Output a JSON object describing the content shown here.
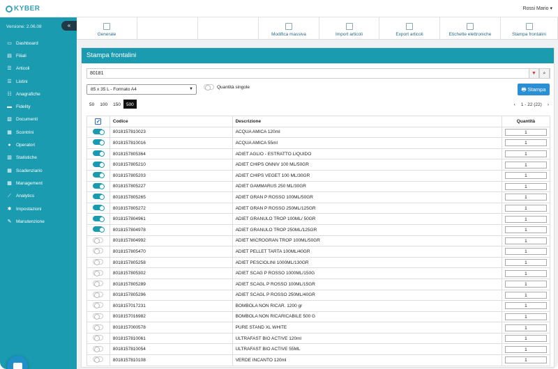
{
  "app": {
    "logo": "KYBER",
    "version": "Versione: 2.06.08",
    "user": "Rossi Mario ▾"
  },
  "sidebar": {
    "items": [
      {
        "label": "Dashboard",
        "icon": "monitor-icon"
      },
      {
        "label": "Filiali",
        "icon": "building-icon"
      },
      {
        "label": "Articoli",
        "icon": "list-icon"
      },
      {
        "label": "Listini",
        "icon": "list-icon"
      },
      {
        "label": "Anagrafiche",
        "icon": "users-icon"
      },
      {
        "label": "Fidelity",
        "icon": "card-icon"
      },
      {
        "label": "Documenti",
        "icon": "folder-icon"
      },
      {
        "label": "Scontrini",
        "icon": "receipt-icon"
      },
      {
        "label": "Operatori",
        "icon": "user-icon"
      },
      {
        "label": "Statistiche",
        "icon": "bar-chart-icon"
      },
      {
        "label": "Scadenziario",
        "icon": "calendar-icon"
      },
      {
        "label": "Management",
        "icon": "grid-icon"
      },
      {
        "label": "Analytics",
        "icon": "line-chart-icon"
      },
      {
        "label": "Impostazioni",
        "icon": "gear-icon"
      },
      {
        "label": "Manutenzione",
        "icon": "wrench-icon"
      }
    ]
  },
  "toolbar": {
    "items": [
      {
        "label": "Generale",
        "width": 87
      },
      {
        "label": "",
        "width": 87
      },
      {
        "label": "",
        "width": 87
      },
      {
        "label": "Modifica massiva",
        "width": 87
      },
      {
        "label": "Import articoli",
        "width": 86
      },
      {
        "label": "Export articoli",
        "width": 87
      },
      {
        "label": "Etichette elettroniche",
        "width": 87
      },
      {
        "label": "Stampa frontalini",
        "width": 82
      }
    ]
  },
  "panel": {
    "title": "Stampa frontalini",
    "search_value": "80181",
    "format_selected": "85 x 35 L - Formato A4",
    "qty_single_label": "Quantità singole",
    "print_label": "Stampa",
    "page_sizes": [
      "50",
      "100",
      "150",
      "500"
    ],
    "page_size_active": "500",
    "page_info": "1 - 22 (22)",
    "columns": {
      "codice": "Codice",
      "descrizione": "Descrizione",
      "quantita": "Quantità"
    }
  },
  "rows": [
    {
      "on": true,
      "codice": "8018157810023",
      "descrizione": "ACQUA AMICA 120ml",
      "qty": "1"
    },
    {
      "on": true,
      "codice": "8018157810016",
      "descrizione": "ACQUA AMICA 55ml",
      "qty": "1"
    },
    {
      "on": true,
      "codice": "8018157805364",
      "descrizione": "ADIET AGLIO - ESTRATTO LIQUIDO",
      "qty": "1"
    },
    {
      "on": true,
      "codice": "8018157805210",
      "descrizione": "ADIET CHIPS ONNIV 100 ML/50GR",
      "qty": "1"
    },
    {
      "on": true,
      "codice": "8018157805203",
      "descrizione": "ADIET CHIPS VEGET 100 ML/30GR",
      "qty": "1"
    },
    {
      "on": true,
      "codice": "8018157805227",
      "descrizione": "ADIET GAMMARUS 250 ML/30GR",
      "qty": "1"
    },
    {
      "on": true,
      "codice": "8018157805265",
      "descrizione": "ADIET GRAN P ROSSO 100ML/50GR",
      "qty": "1"
    },
    {
      "on": true,
      "codice": "8018157805272",
      "descrizione": "ADIET GRAN P ROSSO 250ML/125GR",
      "qty": "1"
    },
    {
      "on": true,
      "codice": "8018157804961",
      "descrizione": "ADIET GRANULO TROP 100ML/ 50GR",
      "qty": "1"
    },
    {
      "on": true,
      "codice": "8018157804978",
      "descrizione": "ADIET GRANULO TROP 250ML/125GR",
      "qty": "1"
    },
    {
      "on": false,
      "codice": "8018157804992",
      "descrizione": "ADIET MICROGRAN TROP 100ML/50GR",
      "qty": "1"
    },
    {
      "on": false,
      "codice": "8018157805470",
      "descrizione": "ADIET PELLET TARTA 100ML/40GR",
      "qty": "1"
    },
    {
      "on": false,
      "codice": "8018157805258",
      "descrizione": "ADIET PESCIOLINI 1000ML/130GR",
      "qty": "1"
    },
    {
      "on": false,
      "codice": "8018157805302",
      "descrizione": "ADIET SCAG P ROSSO 1000ML/150G",
      "qty": "1"
    },
    {
      "on": false,
      "codice": "8018157805289",
      "descrizione": "ADIET SCAGL P ROSSO 100ML/15GR",
      "qty": "1"
    },
    {
      "on": false,
      "codice": "8018157805296",
      "descrizione": "ADIET SCAGL P ROSSO 250ML/40GR",
      "qty": "1"
    },
    {
      "on": false,
      "codice": "8018157017231",
      "descrizione": "BOMBOLA NON RICAR. 1200 gr",
      "qty": "1"
    },
    {
      "on": false,
      "codice": "8018157016982",
      "descrizione": "BOMBOLA NON RICARICABILE 500 G",
      "qty": "1"
    },
    {
      "on": false,
      "codice": "8018157000578",
      "descrizione": "PURE STAND XL WHITE",
      "qty": "1"
    },
    {
      "on": false,
      "codice": "8018157810061",
      "descrizione": "ULTRAFAST BIO ACTIVE 120ml",
      "qty": "1"
    },
    {
      "on": false,
      "codice": "8018157810054",
      "descrizione": "ULTRAFAST BIO ACTIVE 55ML",
      "qty": "1"
    },
    {
      "on": false,
      "codice": "8018157810108",
      "descrizione": "VERDE INCANTO 120ml",
      "qty": "1"
    }
  ]
}
